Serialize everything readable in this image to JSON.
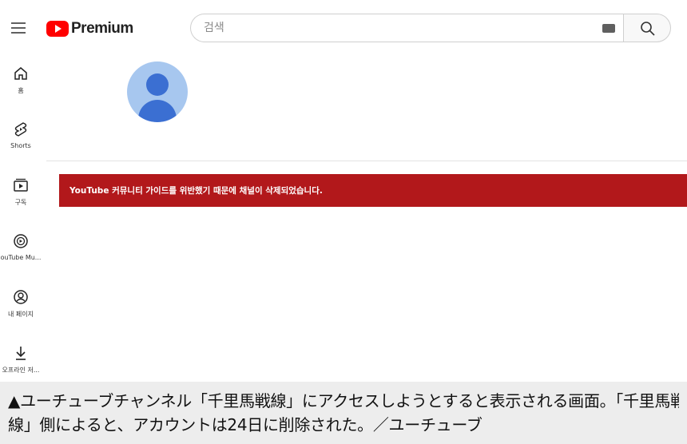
{
  "header": {
    "brand_text": "Premium",
    "search_placeholder": "검색"
  },
  "sidebar": {
    "items": [
      {
        "label": "홈",
        "icon": "home-icon"
      },
      {
        "label": "Shorts",
        "icon": "shorts-icon"
      },
      {
        "label": "구독",
        "icon": "subscriptions-icon"
      },
      {
        "label": "ouTube Mu...",
        "icon": "youtube-music-icon"
      },
      {
        "label": "내 페이지",
        "icon": "my-page-icon"
      },
      {
        "label": "오프라인 저...",
        "icon": "download-icon"
      }
    ]
  },
  "channel": {
    "alert_message": "YouTube 커뮤니티 가이드를 위반했기 때문에 채널이 삭제되었습니다.",
    "alert_color": "#b2181b"
  },
  "caption": {
    "line1": "▲ユーチューブチャンネル「千里馬戦線」にアクセスしようとすると表示される画面。「千里馬戦",
    "line2": "線」側によると、アカウントは24日に削除された。／ユーチューブ"
  }
}
